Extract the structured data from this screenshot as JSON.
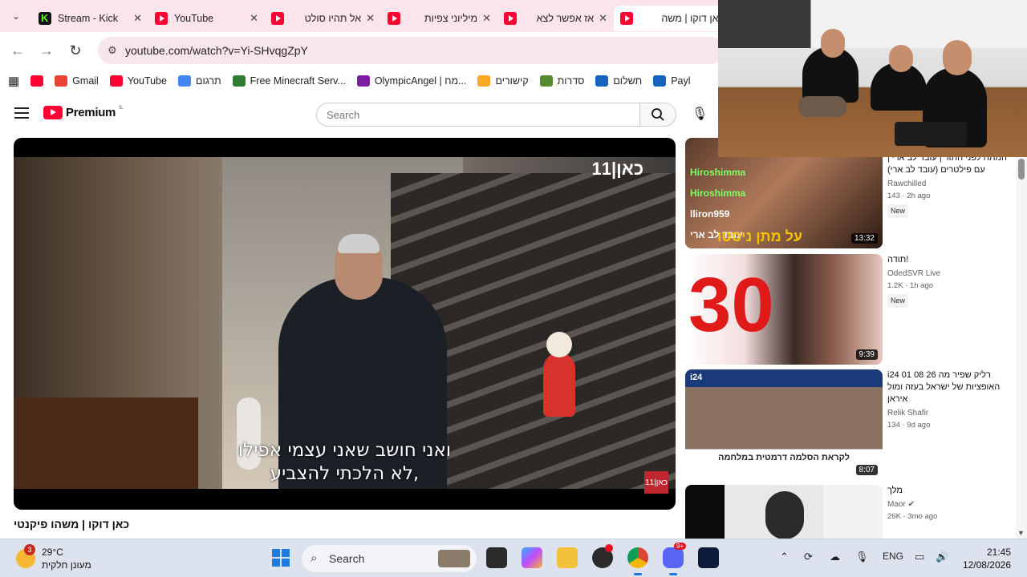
{
  "tabs": [
    {
      "title": "Stream - Kick",
      "icon": "kick"
    },
    {
      "title": "YouTube",
      "icon": "youtube"
    },
    {
      "title": "אל תהיו סולט",
      "icon": "youtube"
    },
    {
      "title": "מיליוני צפיות",
      "icon": "youtube"
    },
    {
      "title": "אז אפשר לצא",
      "icon": "youtube"
    },
    {
      "title": "כאן דוקו | משה",
      "icon": "youtube"
    }
  ],
  "address": {
    "url": "youtube.com/watch?v=Yi-SHvqgZpY"
  },
  "bookmarks": [
    {
      "label": "",
      "color": "#ff0033"
    },
    {
      "label": "Gmail",
      "color": "#ea4335"
    },
    {
      "label": "YouTube",
      "color": "#ff0033"
    },
    {
      "label": "תרגום",
      "color": "#4285f4"
    },
    {
      "label": "Free Minecraft Serv...",
      "color": "#2e7d32"
    },
    {
      "label": "OlympicAngel | מח...",
      "color": "#7b1fa2"
    },
    {
      "label": "קישורים",
      "color": "#f9a825"
    },
    {
      "label": "סדרות",
      "color": "#558b2f"
    },
    {
      "label": "תשלום",
      "color": "#1565c0"
    },
    {
      "label": "Payl",
      "color": "#1565c0"
    }
  ],
  "yt": {
    "logo": "Premium",
    "region": "IL",
    "search_placeholder": "Search"
  },
  "player": {
    "subtitle_line1": "ואני חושב שאני עצמי אפילו",
    "subtitle_line2": "לא הלכתי להצביע,",
    "channel_mark": "כאן|11",
    "corner_mark": "כאן|11"
  },
  "video_title": "כאן דוקו | משהו פיקנטי",
  "recommendations": [
    {
      "title": "המתח לפני התור | עובד לב ארי | עם פילטרים (עובד לב ארי)",
      "channel": "Rawchilled",
      "meta": "143 · 2h ago",
      "badge": "New",
      "duration": "13:32",
      "thumb_text": "על מתן ניסטו"
    },
    {
      "title": "תודה!",
      "channel": "OdedSVR Live",
      "meta": "1.2K · 1h ago",
      "badge": "New",
      "duration": "9:39",
      "thumb_text": "30"
    },
    {
      "title": "רליק שפיר מה 26 08 01 i24 האופציות של ישראל בעזה ומול איראן",
      "channel": "Relik Shafir",
      "meta": "134 · 9d ago",
      "badge": "",
      "duration": "8:07",
      "thumb_text": "לקראת הסלמה דרמטית במלחמה"
    },
    {
      "title": "מלך",
      "channel": "Maor",
      "meta": "26K · 3mo ago",
      "badge": "",
      "duration": "",
      "thumb_text": ""
    }
  ],
  "chat": [
    "Hiroshimma",
    "Hiroshimma",
    "lliron959",
    "עובד לב ארי"
  ],
  "taskbar": {
    "temp": "29°C",
    "weather": "מעונן חלקית",
    "notif": "3",
    "search": "Search",
    "lang": "ENG",
    "time": "21:45",
    "date": "12/08/2026",
    "discord_badge": "9+"
  }
}
